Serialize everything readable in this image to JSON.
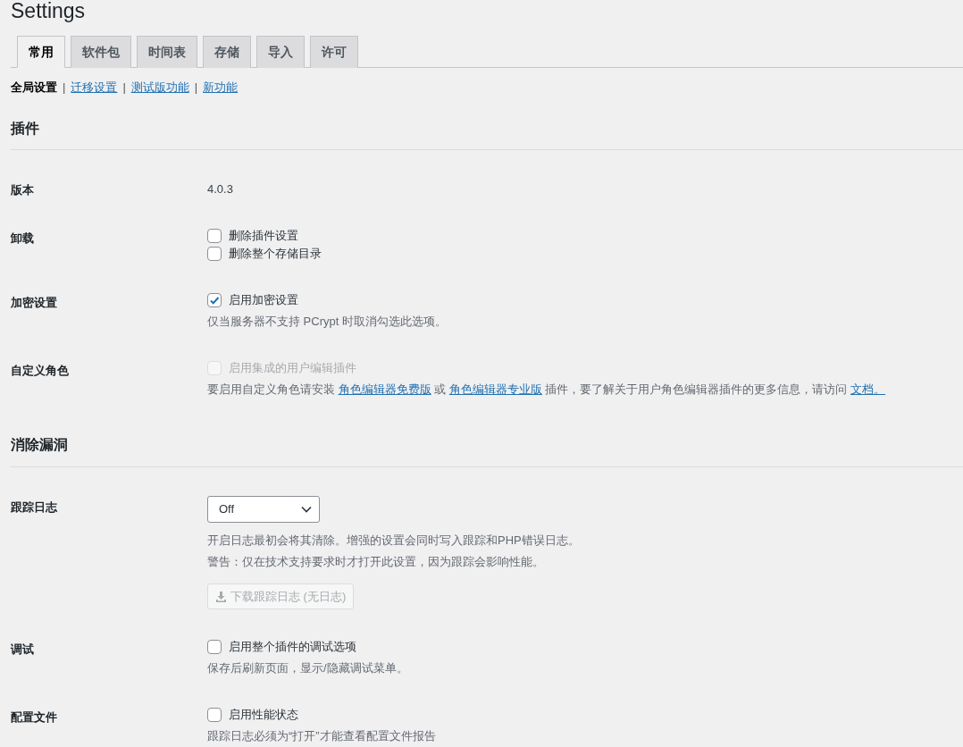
{
  "page_title": "Settings",
  "tabs": [
    {
      "label": "常用",
      "selected": true
    },
    {
      "label": "软件包",
      "selected": false
    },
    {
      "label": "时间表",
      "selected": false
    },
    {
      "label": "存储",
      "selected": false
    },
    {
      "label": "导入",
      "selected": false
    },
    {
      "label": "许可",
      "selected": false
    }
  ],
  "subnav": [
    {
      "label": "全局设置",
      "selected": true
    },
    {
      "separator": "|",
      "label": "迁移设置",
      "selected": false
    },
    {
      "separator": "|",
      "label": "测试版功能",
      "selected": false
    },
    {
      "separator": "|",
      "label": "新功能",
      "selected": false
    }
  ],
  "sections": [
    {
      "title": "插件",
      "rows": [
        {
          "label": "版本",
          "items": [
            {
              "kind": "text",
              "text": "4.0.3"
            }
          ]
        },
        {
          "label": "卸载",
          "items": [
            {
              "kind": "checkbox",
              "label": "删除插件设置",
              "checked": false,
              "disabled": false
            },
            {
              "kind": "checkbox",
              "label": "删除整个存储目录",
              "checked": false,
              "disabled": false
            }
          ]
        },
        {
          "label": "加密设置",
          "items": [
            {
              "kind": "checkbox",
              "label": "启用加密设置",
              "checked": true,
              "disabled": false
            },
            {
              "kind": "description",
              "segments": [
                {
                  "kind": "text",
                  "text": "仅当服务器不支持 PCrypt 时取消勾选此选项。"
                }
              ]
            }
          ]
        },
        {
          "label": "自定义角色",
          "items": [
            {
              "kind": "checkbox",
              "label": "启用集成的用户编辑插件",
              "checked": false,
              "disabled": true
            },
            {
              "kind": "description",
              "segments": [
                {
                  "kind": "text",
                  "text": "要启用自定义角色请安装 "
                },
                {
                  "kind": "link",
                  "text": "角色编辑器免费版"
                },
                {
                  "kind": "text",
                  "text": " 或 "
                },
                {
                  "kind": "link",
                  "text": "角色编辑器专业版"
                },
                {
                  "kind": "text",
                  "text": " 插件，要了解关于用户角色编辑器插件的更多信息，请访问 "
                },
                {
                  "kind": "link",
                  "text": "文档。"
                }
              ]
            }
          ]
        }
      ]
    },
    {
      "title": "消除漏洞",
      "rows": [
        {
          "label": "跟踪日志",
          "items": [
            {
              "kind": "select",
              "value": "Off"
            },
            {
              "kind": "description",
              "segments": [
                {
                  "kind": "text",
                  "text": "开启日志最初会将其清除。增强的设置会同时写入跟踪和PHP错误日志。"
                }
              ]
            },
            {
              "kind": "description",
              "segments": [
                {
                  "kind": "text",
                  "text": "警告：仅在技术支持要求时才打开此设置，因为跟踪会影响性能。"
                }
              ]
            },
            {
              "kind": "button",
              "label": "下载跟踪日志 (无日志)",
              "disabled": true
            }
          ]
        },
        {
          "label": "调试",
          "items": [
            {
              "kind": "checkbox",
              "label": "启用整个插件的调试选项",
              "checked": false,
              "disabled": false
            },
            {
              "kind": "description",
              "segments": [
                {
                  "kind": "text",
                  "text": "保存后刷新页面，显示/隐藏调试菜单。"
                }
              ]
            }
          ]
        },
        {
          "label": "配置文件",
          "items": [
            {
              "kind": "checkbox",
              "label": "启用性能状态",
              "checked": false,
              "disabled": false
            },
            {
              "kind": "description",
              "segments": [
                {
                  "kind": "text",
                  "text": "跟踪日志必须为“打开”才能查看配置文件报告"
                }
              ]
            }
          ]
        }
      ]
    }
  ]
}
